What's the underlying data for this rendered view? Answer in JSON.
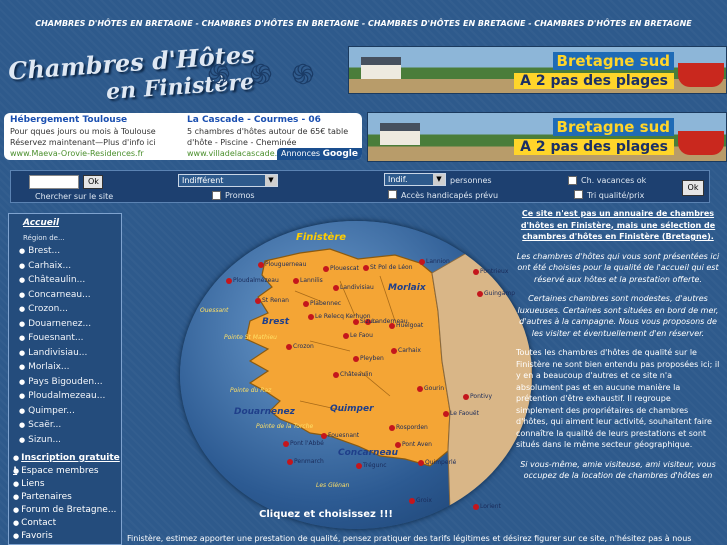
{
  "header": {
    "strip_text": "CHAMBRES D'HÔTES EN BRETAGNE - CHAMBRES D'HÔTES EN BRETAGNE - CHAMBRES D'HÔTES EN BRETAGNE - CHAMBRES D'HÔTES EN BRETAGNE",
    "logo_line1": "Chambres d'Hôtes",
    "logo_line2": "en Finistère"
  },
  "banners": {
    "title": "Bretagne sud",
    "subtitle": "A 2 pas des plages"
  },
  "ads": {
    "left": {
      "title": "Hébergement Toulouse",
      "line1": "Pour qques jours ou mois à Toulouse",
      "line2": "Réservez maintenant—Plus d'info ici",
      "url": "www.Maeva-Orovie-Residences.fr"
    },
    "right": {
      "title": "La Cascade - Courmes - 06",
      "line1": "5 chambres d'hôtes autour de 65€ table",
      "line2": "d'hôte - Piscine - Cheminée",
      "url": "www.villadelacascade.com"
    },
    "by_prefix": "Annonces",
    "by_brand": "Google"
  },
  "search": {
    "site_ok": "Ok",
    "site_label": "Chercher sur le site",
    "commune_value": "Indifférent",
    "promos_label": "Promos",
    "persons_value": "Indif.",
    "persons_label": "personnes",
    "handicap_label": "Accès handicapés prévu",
    "cv_label": "Ch. vacances ok",
    "tri_label": "Tri qualité/prix",
    "go_ok": "Ok"
  },
  "sidebar": {
    "home": "Accueil",
    "region_label": "Région de...",
    "regions": [
      "Brest...",
      "Carhaix...",
      "Châteaulin...",
      "Concarneau...",
      "Crozon...",
      "Douarnenez...",
      "Fouesnant...",
      "Landivisiau...",
      "Morlaix...",
      "Pays Bigouden...",
      "Ploudalmezeau...",
      "Quimper...",
      "Scaër...",
      "Sizun..."
    ],
    "links": [
      "Inscription gratuite !",
      "Espace membres",
      "Liens",
      "Partenaires",
      "Forum de Bretagne...",
      "Contact",
      "Favoris"
    ]
  },
  "map": {
    "title": "Finistère",
    "caption": "Cliquez et choisissez !!!",
    "big_towns": [
      "Morlaix",
      "Brest",
      "Douarnenez",
      "Quimper",
      "Concarneau"
    ],
    "towns": [
      "Plouguerneau",
      "Ploudalmézeau",
      "Lannilis",
      "Plouescat",
      "St Pol de Léon",
      "Landivisiau",
      "St Renan",
      "Plabennec",
      "Le Relecq Kerhuon",
      "Landerneau",
      "Sizun",
      "Le Faou",
      "Huelgoat",
      "Crozon",
      "Châteaulin",
      "Pleyben",
      "Carhaix",
      "Pont l'Abbé",
      "Fouesnant",
      "Rosporden",
      "Pont Aven",
      "Quimperlé",
      "Trégunc",
      "Penmarch",
      "Lannion",
      "Guingamp",
      "Pontrieux",
      "Pontivy",
      "Gourin",
      "Le Faouët",
      "Lorient",
      "Groix"
    ],
    "sea_labels": [
      "Ouessant",
      "Pointe St Mathieu",
      "Pointe du Raz",
      "Pointe de la Torche",
      "Les Glénan"
    ]
  },
  "right_panel": {
    "intro": "Ce site n'est pas un annuaire de chambres d'hôtes en Finistère, mais une sélection de chambres d'hôtes en Finistère (Bretagne).",
    "p1": "Les chambres d'hôtes qui vous sont présentées ici ont été choisies pour la qualité de l'accueil qui est réservé aux hôtes et la prestation offerte.",
    "p2": "Certaines chambres sont modestes, d'autres luxueuses. Certaines sont situées en bord de mer, d'autres à la campagne. Nous vous proposons de les visiter et éventuellement d'en réserver.",
    "p3": "Toutes les chambres d'hôtes de qualité sur le Finistère ne sont bien entendu pas proposées ici; il y en a beaucoup d'autres et ce site n'a absolument pas et en aucune manière la prétention d'être exhaustif. Il regroupe simplement des propriétaires de chambres d'hôtes, qui aiment leur activité, souhaitent faire connaître la qualité de leurs prestations et sont situés dans le même secteur géographique.",
    "p4": "Si vous-même, amie visiteuse, ami visiteur, vous occupez de la location de chambres d'hôtes en"
  },
  "bottom_text": "Finistère, estimez apporter une prestation de qualité, pensez pratiquer des tarifs légitimes et désirez figurer sur ce site, n'hésitez pas à nous"
}
